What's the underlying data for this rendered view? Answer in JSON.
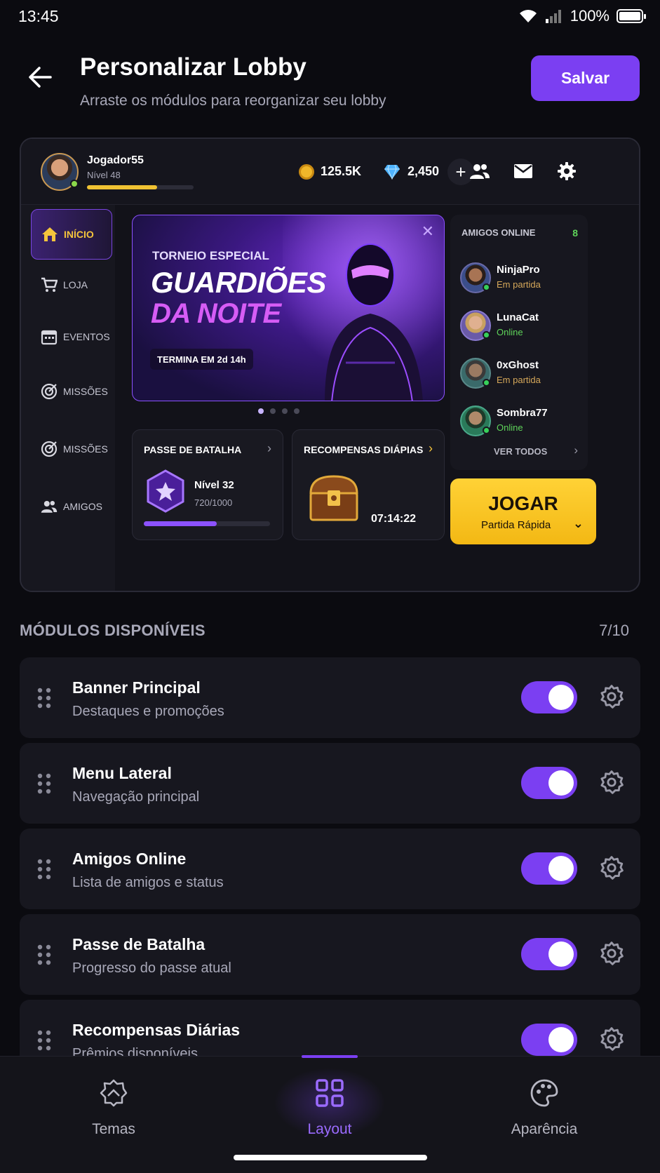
{
  "status_bar": {
    "time": "13:45",
    "battery": "100%"
  },
  "header": {
    "title": "Personalizar Lobby",
    "subtitle": "Arraste os módulos para reorganizar seu lobby",
    "save_label": "Salvar"
  },
  "preview": {
    "player": {
      "name": "Jogador55",
      "level": "Nível 48",
      "xp_progress": 0.66
    },
    "coins": "125.5K",
    "gems": "2,450",
    "side_menu": [
      {
        "label": "INÍCIO",
        "icon": "home-icon",
        "active": true
      },
      {
        "label": "LOJA",
        "icon": "cart-icon",
        "active": false
      },
      {
        "label": "EVENTOS",
        "icon": "calendar-icon",
        "active": false
      },
      {
        "label": "MISSÕES",
        "icon": "target-icon",
        "active": false
      },
      {
        "label": "MISSÕES",
        "icon": "target-icon",
        "active": false
      },
      {
        "label": "AMIGOS",
        "icon": "users-icon",
        "active": false
      }
    ],
    "banner": {
      "kicker": "TORNEIO ESPECIAL",
      "title_line1": "GUARDIÕES",
      "title_line2": "DA NOITE",
      "ends": "TERMINA EM 2d 14h",
      "slide_count": 4,
      "active_slide": 0
    },
    "battle_pass": {
      "title": "PASSE DE BATALHA",
      "level": "Nível 32",
      "xp": "720/1000",
      "progress": 0.58
    },
    "rewards": {
      "title": "RECOMPENSAS DIÁPIAS",
      "timer": "07:14:22"
    },
    "friends": {
      "title": "AMIGOS ONLINE",
      "count": "8",
      "items": [
        {
          "name": "NinjaPro",
          "status": "Em partida"
        },
        {
          "name": "LunaCat",
          "status": "Online"
        },
        {
          "name": "0xGhost",
          "status": "Em partida"
        },
        {
          "name": "Sombra77",
          "status": "Online"
        }
      ],
      "see_all": "VER TODOS"
    },
    "play": {
      "label": "JOGAR",
      "mode": "Partida Rápida"
    }
  },
  "modules_section": {
    "title": "MÓDULOS DISPONÍVEIS",
    "count": "7/10",
    "items": [
      {
        "name": "Banner Principal",
        "description": "Destaques e promoções",
        "enabled": true
      },
      {
        "name": "Menu Lateral",
        "description": "Navegação principal",
        "enabled": true
      },
      {
        "name": "Amigos Online",
        "description": "Lista de amigos e status",
        "enabled": true
      },
      {
        "name": "Passe de Batalha",
        "description": "Progresso do passe atual",
        "enabled": true
      },
      {
        "name": "Recompensas Diárias",
        "description": "Prêmios disponíveis",
        "enabled": true
      }
    ]
  },
  "bottom_nav": [
    {
      "label": "Temas",
      "icon": "themes-icon",
      "active": false
    },
    {
      "label": "Layout",
      "icon": "grid-icon",
      "active": true
    },
    {
      "label": "Aparência",
      "icon": "palette-icon",
      "active": false
    }
  ],
  "colors": {
    "accent": "#7b3ff2",
    "play_button": "#ffd236",
    "online": "#5fd45a",
    "in_game": "#d6a85a",
    "background": "#0b0b10"
  }
}
